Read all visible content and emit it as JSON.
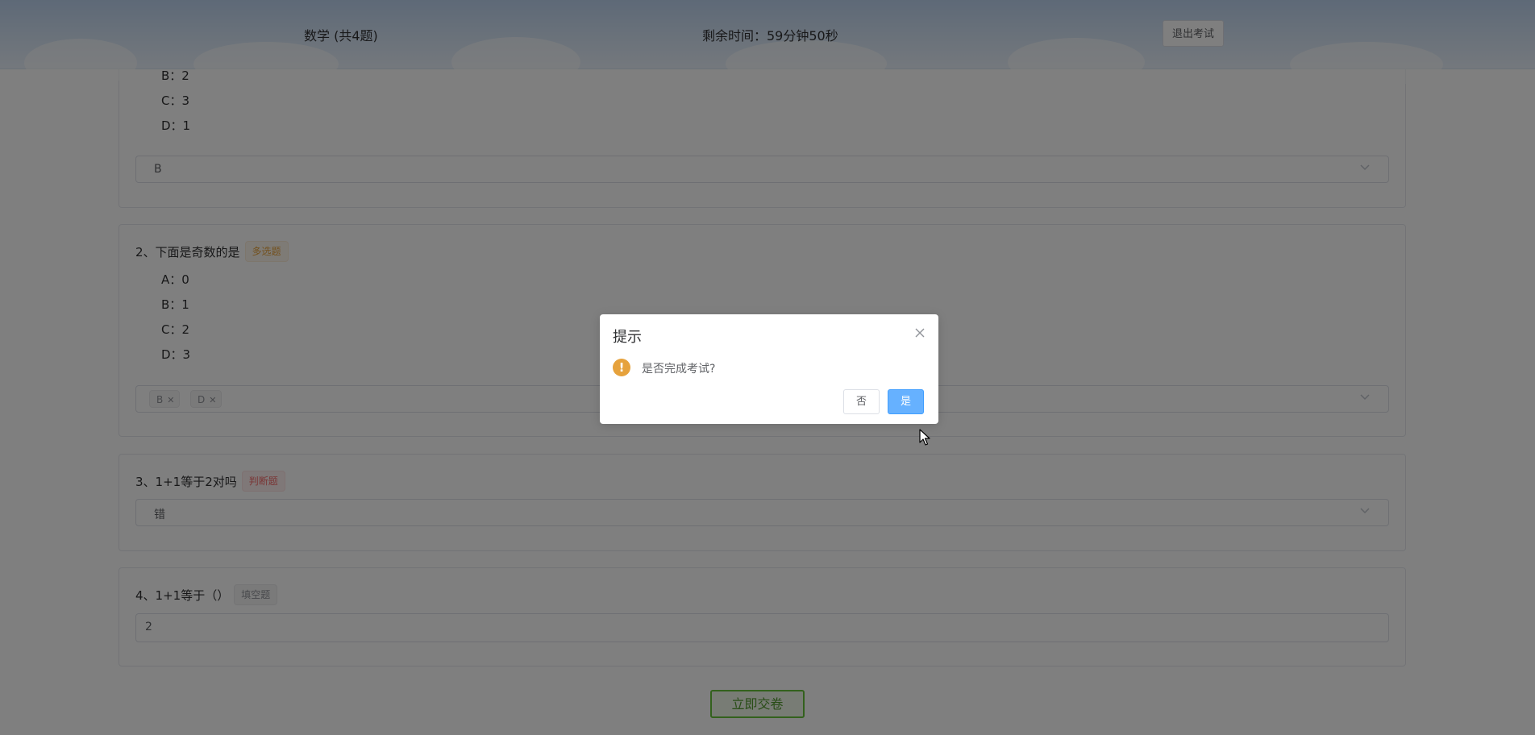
{
  "header": {
    "title": "数学 (共4题)",
    "timer": "剩余时间：59分钟50秒",
    "exit_label": "退出考试"
  },
  "questions": [
    {
      "options": [
        "B：2",
        "C：3",
        "D：1"
      ],
      "answer": "B"
    },
    {
      "title": "2、下面是奇数的是",
      "tag": "多选题",
      "options": [
        "A：0",
        "B：1",
        "C：2",
        "D：3"
      ],
      "selected": [
        "B",
        "D"
      ]
    },
    {
      "title": "3、1+1等于2对吗",
      "tag": "判断题",
      "answer": "错"
    },
    {
      "title": "4、1+1等于（）",
      "tag": "填空题",
      "answer": "2"
    }
  ],
  "submit_label": "立即交卷",
  "dialog": {
    "title": "提示",
    "message": "是否完成考试?",
    "cancel_label": "否",
    "confirm_label": "是"
  },
  "colors": {
    "warning": "#e6a23c",
    "danger": "#f56c6c",
    "primary": "#409eff",
    "success": "#67c23a",
    "overlay": "rgba(0,0,0,0.5)"
  }
}
